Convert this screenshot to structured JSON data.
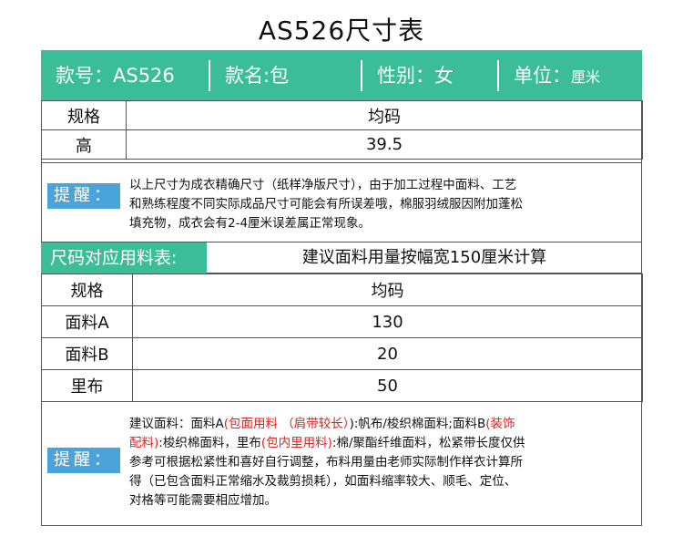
{
  "title": "AS526尺寸表",
  "header_bar": {
    "style_no": "款号：AS526",
    "style_name": "款名:包",
    "gender": "性别：女",
    "unit_label": "单位：",
    "unit_value": "厘米"
  },
  "size_table": {
    "headers": [
      "规格",
      "均码"
    ],
    "rows": [
      {
        "label": "高",
        "value": "39.5"
      }
    ]
  },
  "reminder1": {
    "badge": "提醒：",
    "lines": [
      "以上尺寸为成衣精确尺寸（纸样净版尺寸），由于加工过程中面料、工艺",
      "和熟练程度不同实际成品尺寸可能会有所误差哦，棉服羽绒服因附加蓬松",
      "填充物，成衣会有2-4厘米误差属正常现象。"
    ]
  },
  "fabric_ref": {
    "label": "尺码对应用料表:",
    "note": "建议面料用量按幅宽150厘米计算"
  },
  "fabric_table": {
    "headers": [
      "规格",
      "均码"
    ],
    "rows": [
      {
        "label": "面料A",
        "value": "130"
      },
      {
        "label": "面料B",
        "value": "20"
      },
      {
        "label": "里布",
        "value": "50"
      }
    ]
  },
  "reminder2": {
    "badge": "提醒：",
    "l1a": "建议面料：面料A",
    "l1b": "(包面用料 （肩带较长）",
    "l1c": "):帆布/梭织棉面料;面料B",
    "l1d": "(装饰",
    "l2a": "配料)",
    "l2b": ":梭织棉面料，里布",
    "l2c": "(包内里用料)",
    "l2d": ":棉/聚酯纤维面料，松紧带长度仅供",
    "l3": "参考可根据松紧性和喜好自行调整，布料用量由老师实际制作样衣计算所",
    "l4": "得（已包含面料正常缩水及裁剪损耗），如面料缩率较大、顺毛、定位、",
    "l5": "对格等可能需要相应增加。"
  },
  "colors": {
    "accent_teal": "#3bbd98",
    "badge_blue": "#4aa3d9",
    "highlight_red": "#e02020"
  }
}
